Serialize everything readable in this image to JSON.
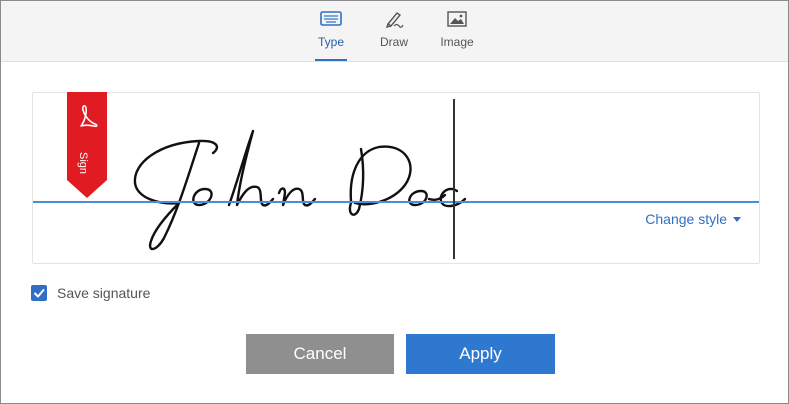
{
  "tabs": [
    {
      "label": "Type",
      "icon": "keyboard-icon",
      "active": true
    },
    {
      "label": "Draw",
      "icon": "pen-icon",
      "active": false
    },
    {
      "label": "Image",
      "icon": "image-icon",
      "active": false
    }
  ],
  "signature": {
    "text": "John Doe",
    "badge_label": "Sign",
    "badge_color": "#e11b22",
    "change_style_label": "Change style"
  },
  "save_signature": {
    "label": "Save signature",
    "checked": true
  },
  "buttons": {
    "cancel_label": "Cancel",
    "apply_label": "Apply"
  },
  "colors": {
    "accent": "#2f78d0",
    "cancel": "#8f8f8f"
  }
}
